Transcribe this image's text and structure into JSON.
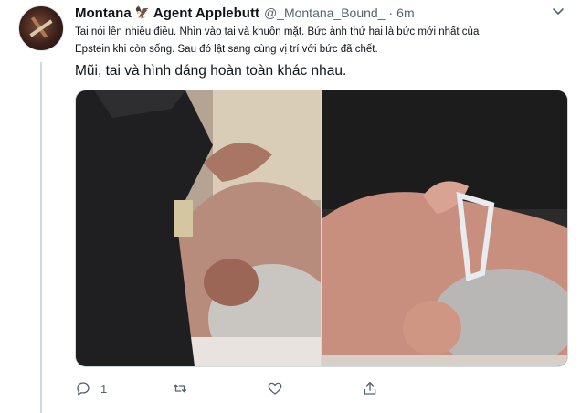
{
  "tweet": {
    "display_name": "Montana",
    "name_emoji": "🦅",
    "display_name_suffix": "Agent Applebutt",
    "handle": "@_Montana_Bound_",
    "separator": "·",
    "time": "6m",
    "text_line1": "Tai nói lên nhiều điều. Nhìn vào tai và khuôn mặt. Bức ảnh thứ hai là bức mới nhất của",
    "text_line2": "Epstein khi còn sống. Sau đó lật sang cùng vị trí với bức đã chết.",
    "text_large": "Mũi, tai và hình dáng hoàn toàn khác nhau."
  },
  "actions": {
    "reply_count": "1",
    "retweet_count": "",
    "like_count": ""
  },
  "icons": {
    "avatar": "avatar-image",
    "caret": "chevron-down-icon",
    "reply": "reply-icon",
    "retweet": "retweet-icon",
    "like": "heart-icon",
    "share": "share-icon"
  },
  "colors": {
    "text_primary": "#0f1419",
    "text_secondary": "#536471",
    "border": "#cfd9de",
    "thread_line": "#cfd9de"
  }
}
